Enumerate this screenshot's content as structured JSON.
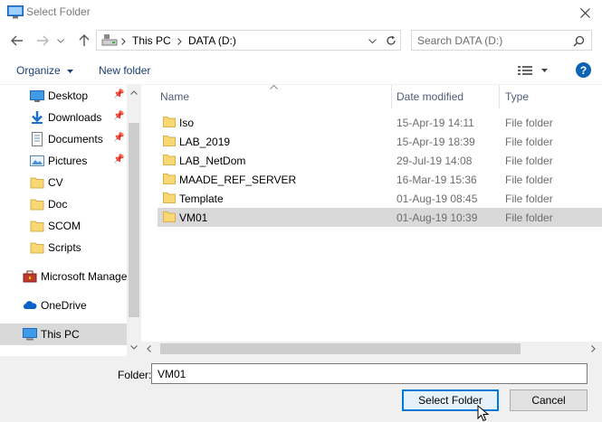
{
  "window": {
    "title": "Select Folder"
  },
  "address": {
    "crumbs": [
      "This PC",
      "DATA (D:)"
    ]
  },
  "search": {
    "placeholder": "Search DATA (D:)"
  },
  "toolbar": {
    "organize_label": "Organize",
    "new_folder_label": "New folder"
  },
  "sidebar": {
    "items": [
      {
        "label": "Desktop",
        "icon": "desktop-icon",
        "pinned": true
      },
      {
        "label": "Downloads",
        "icon": "download-icon",
        "pinned": true
      },
      {
        "label": "Documents",
        "icon": "document-icon",
        "pinned": true
      },
      {
        "label": "Pictures",
        "icon": "pictures-icon",
        "pinned": true
      },
      {
        "label": "CV",
        "icon": "folder-icon",
        "pinned": false
      },
      {
        "label": "Doc",
        "icon": "folder-icon",
        "pinned": false
      },
      {
        "label": "SCOM",
        "icon": "folder-icon",
        "pinned": false
      },
      {
        "label": "Scripts",
        "icon": "folder-icon",
        "pinned": false
      },
      {
        "label": "Microsoft Manage",
        "icon": "management-icon",
        "pinned": false
      },
      {
        "label": "OneDrive",
        "icon": "cloud-icon",
        "pinned": false
      },
      {
        "label": "This PC",
        "icon": "computer-icon",
        "pinned": false,
        "selected": true
      }
    ]
  },
  "list": {
    "columns": {
      "name": "Name",
      "date": "Date modified",
      "type": "Type"
    },
    "rows": [
      {
        "name": "Iso",
        "date": "15-Apr-19 14:11",
        "type": "File folder"
      },
      {
        "name": "LAB_2019",
        "date": "15-Apr-19 18:39",
        "type": "File folder"
      },
      {
        "name": "LAB_NetDom",
        "date": "29-Jul-19 14:08",
        "type": "File folder"
      },
      {
        "name": "MAADE_REF_SERVER",
        "date": "16-Mar-19 15:36",
        "type": "File folder"
      },
      {
        "name": "Template",
        "date": "01-Aug-19 08:45",
        "type": "File folder"
      },
      {
        "name": "VM01",
        "date": "01-Aug-19 10:39",
        "type": "File folder",
        "selected": true
      }
    ]
  },
  "footer": {
    "folder_label": "Folder:",
    "folder_value": "VM01",
    "select_label": "Select Folder",
    "cancel_label": "Cancel"
  },
  "colors": {
    "accent": "#0078d7",
    "folder": "#f8d775",
    "selection": "#d9d9d9",
    "link": "#1a3e73"
  }
}
